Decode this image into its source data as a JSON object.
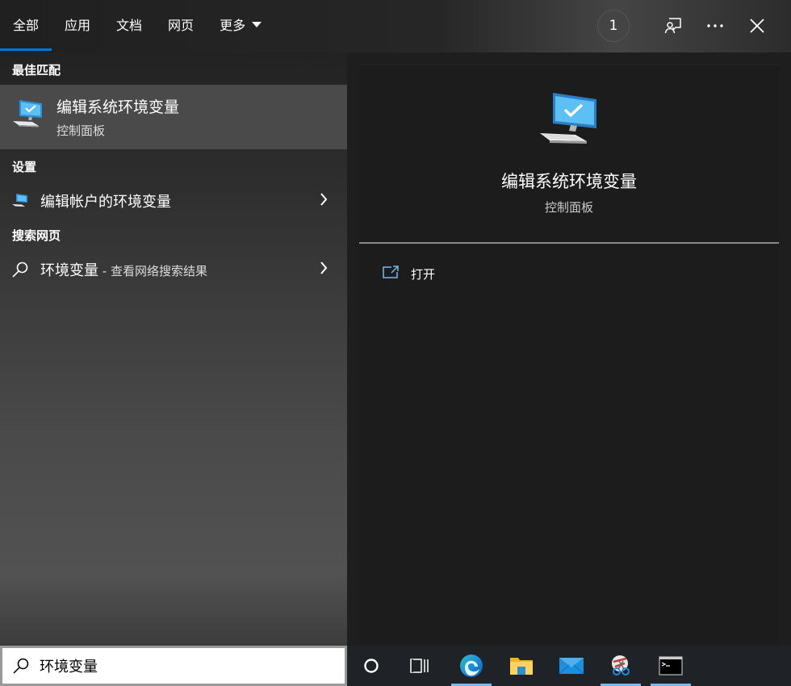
{
  "tabs": [
    {
      "label": "全部",
      "active": true
    },
    {
      "label": "应用",
      "active": false
    },
    {
      "label": "文档",
      "active": false
    },
    {
      "label": "网页",
      "active": false
    },
    {
      "label": "更多",
      "active": false
    }
  ],
  "header": {
    "badge_count": "1",
    "icons": [
      "feedback-icon",
      "more-icon",
      "close-icon"
    ]
  },
  "sections": {
    "best_match": "最佳匹配",
    "settings": "设置",
    "search_web": "搜索网页"
  },
  "best_match": {
    "title": "编辑系统环境变量",
    "subtitle": "控制面板",
    "icon": "computer-check-icon"
  },
  "settings_item": {
    "label": "编辑帐户的环境变量",
    "icon": "computer-icon"
  },
  "web_item": {
    "query": "环境变量",
    "suffix": " - 查看网络搜索结果",
    "icon": "search-icon"
  },
  "detail": {
    "title": "编辑系统环境变量",
    "subtitle": "控制面板",
    "actions": [
      {
        "label": "打开",
        "icon": "open-icon"
      }
    ]
  },
  "search": {
    "value": "环境变量"
  },
  "taskbar": {
    "items": [
      "cortana-icon",
      "task-view-icon",
      "edge-icon",
      "file-explorer-icon",
      "mail-icon",
      "snipping-tool-icon",
      "terminal-icon"
    ]
  },
  "colors": {
    "accent": "#0078d7",
    "taskbar_indicator": "#76b9ed"
  }
}
